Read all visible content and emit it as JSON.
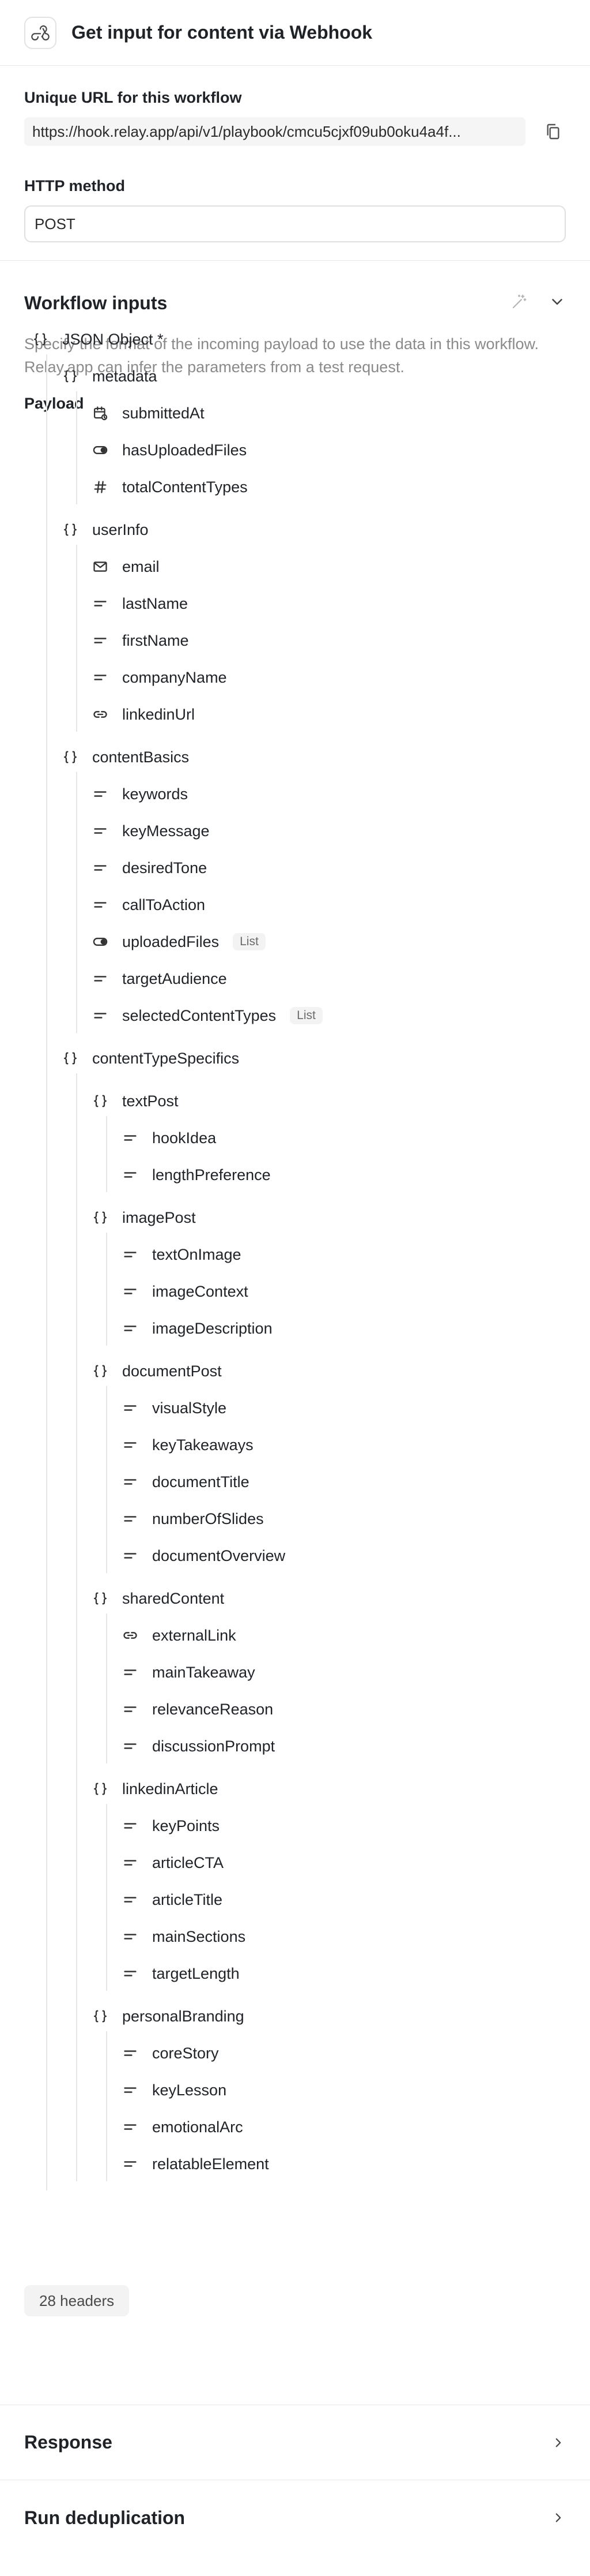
{
  "header": {
    "title": "Get input for content via Webhook",
    "icon": "webhook-icon"
  },
  "url_section": {
    "url_label": "Unique URL for this workflow",
    "url_value": "https://hook.relay.app/api/v1/playbook/cmcu5cjxf09ub0oku4a4f...",
    "method_label": "HTTP method",
    "method_value": "POST"
  },
  "inputs": {
    "title": "Workflow inputs",
    "description": "Specify the format of the incoming payload to use the data in this workflow. Relay.app can infer the parameters from a test request.",
    "payload_label": "Payload",
    "root_label": "JSON Object *",
    "nodes": [
      {
        "label": "metadata",
        "icon": "braces-icon",
        "depth": 1
      },
      {
        "label": "submittedAt",
        "icon": "calendar-icon",
        "depth": 2
      },
      {
        "label": "hasUploadedFiles",
        "icon": "toggle-icon",
        "depth": 2
      },
      {
        "label": "totalContentTypes",
        "icon": "hash-icon",
        "depth": 2
      },
      {
        "label": "userInfo",
        "icon": "braces-icon",
        "depth": 1
      },
      {
        "label": "email",
        "icon": "mail-icon",
        "depth": 2
      },
      {
        "label": "lastName",
        "icon": "text-icon",
        "depth": 2
      },
      {
        "label": "firstName",
        "icon": "text-icon",
        "depth": 2
      },
      {
        "label": "companyName",
        "icon": "text-icon",
        "depth": 2
      },
      {
        "label": "linkedinUrl",
        "icon": "link-icon",
        "depth": 2
      },
      {
        "label": "contentBasics",
        "icon": "braces-icon",
        "depth": 1
      },
      {
        "label": "keywords",
        "icon": "text-icon",
        "depth": 2
      },
      {
        "label": "keyMessage",
        "icon": "text-icon",
        "depth": 2
      },
      {
        "label": "desiredTone",
        "icon": "text-icon",
        "depth": 2
      },
      {
        "label": "callToAction",
        "icon": "text-icon",
        "depth": 2
      },
      {
        "label": "uploadedFiles",
        "icon": "toggle-icon",
        "depth": 2,
        "badge": "List"
      },
      {
        "label": "targetAudience",
        "icon": "text-icon",
        "depth": 2
      },
      {
        "label": "selectedContentTypes",
        "icon": "text-icon",
        "depth": 2,
        "badge": "List"
      },
      {
        "label": "contentTypeSpecifics",
        "icon": "braces-icon",
        "depth": 1
      },
      {
        "label": "textPost",
        "icon": "braces-icon",
        "depth": 2
      },
      {
        "label": "hookIdea",
        "icon": "text-icon",
        "depth": 3
      },
      {
        "label": "lengthPreference",
        "icon": "text-icon",
        "depth": 3
      },
      {
        "label": "imagePost",
        "icon": "braces-icon",
        "depth": 2
      },
      {
        "label": "textOnImage",
        "icon": "text-icon",
        "depth": 3
      },
      {
        "label": "imageContext",
        "icon": "text-icon",
        "depth": 3
      },
      {
        "label": "imageDescription",
        "icon": "text-icon",
        "depth": 3
      },
      {
        "label": "documentPost",
        "icon": "braces-icon",
        "depth": 2
      },
      {
        "label": "visualStyle",
        "icon": "text-icon",
        "depth": 3
      },
      {
        "label": "keyTakeaways",
        "icon": "text-icon",
        "depth": 3
      },
      {
        "label": "documentTitle",
        "icon": "text-icon",
        "depth": 3
      },
      {
        "label": "numberOfSlides",
        "icon": "text-icon",
        "depth": 3
      },
      {
        "label": "documentOverview",
        "icon": "text-icon",
        "depth": 3
      },
      {
        "label": "sharedContent",
        "icon": "braces-icon",
        "depth": 2
      },
      {
        "label": "externalLink",
        "icon": "link-icon",
        "depth": 3
      },
      {
        "label": "mainTakeaway",
        "icon": "text-icon",
        "depth": 3
      },
      {
        "label": "relevanceReason",
        "icon": "text-icon",
        "depth": 3
      },
      {
        "label": "discussionPrompt",
        "icon": "text-icon",
        "depth": 3
      },
      {
        "label": "linkedinArticle",
        "icon": "braces-icon",
        "depth": 2
      },
      {
        "label": "keyPoints",
        "icon": "text-icon",
        "depth": 3
      },
      {
        "label": "articleCTA",
        "icon": "text-icon",
        "depth": 3
      },
      {
        "label": "articleTitle",
        "icon": "text-icon",
        "depth": 3
      },
      {
        "label": "mainSections",
        "icon": "text-icon",
        "depth": 3
      },
      {
        "label": "targetLength",
        "icon": "text-icon",
        "depth": 3
      },
      {
        "label": "personalBranding",
        "icon": "braces-icon",
        "depth": 2
      },
      {
        "label": "coreStory",
        "icon": "text-icon",
        "depth": 3
      },
      {
        "label": "keyLesson",
        "icon": "text-icon",
        "depth": 3
      },
      {
        "label": "emotionalArc",
        "icon": "text-icon",
        "depth": 3
      },
      {
        "label": "relatableElement",
        "icon": "text-icon",
        "depth": 3
      }
    ],
    "headers_badge": "28 headers"
  },
  "response": {
    "title": "Response"
  },
  "dedup": {
    "title": "Run deduplication"
  },
  "colors": {
    "border": "#e6e6e6",
    "muted": "#8a8a8a",
    "text": "#1f2328"
  }
}
